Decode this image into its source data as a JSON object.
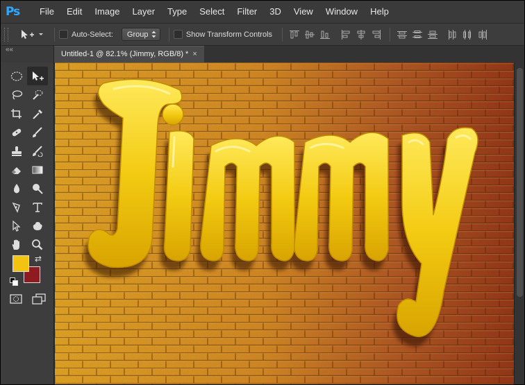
{
  "app": {
    "logo_text": "Ps"
  },
  "menu": {
    "items": [
      "File",
      "Edit",
      "Image",
      "Layer",
      "Type",
      "Select",
      "Filter",
      "3D",
      "View",
      "Window",
      "Help"
    ]
  },
  "options": {
    "auto_select_label": "Auto-Select:",
    "auto_select_checked": false,
    "auto_select_target": "Group",
    "transform_controls_label": "Show Transform Controls",
    "transform_controls_checked": false
  },
  "panel_collapse_glyph": "««",
  "document": {
    "tab_title": "Untitled-1 @ 82.1% (Jimmy, RGB/8) *",
    "tab_close_glyph": "×",
    "canvas_text": "Jimmy"
  },
  "colors": {
    "foreground": "#f2c40f",
    "background": "#8e1b1f",
    "accent": "#31a8ff",
    "text_fill": "#f3cb12",
    "brick_left": "#e7a72b",
    "brick_right": "#8f2a1c"
  }
}
